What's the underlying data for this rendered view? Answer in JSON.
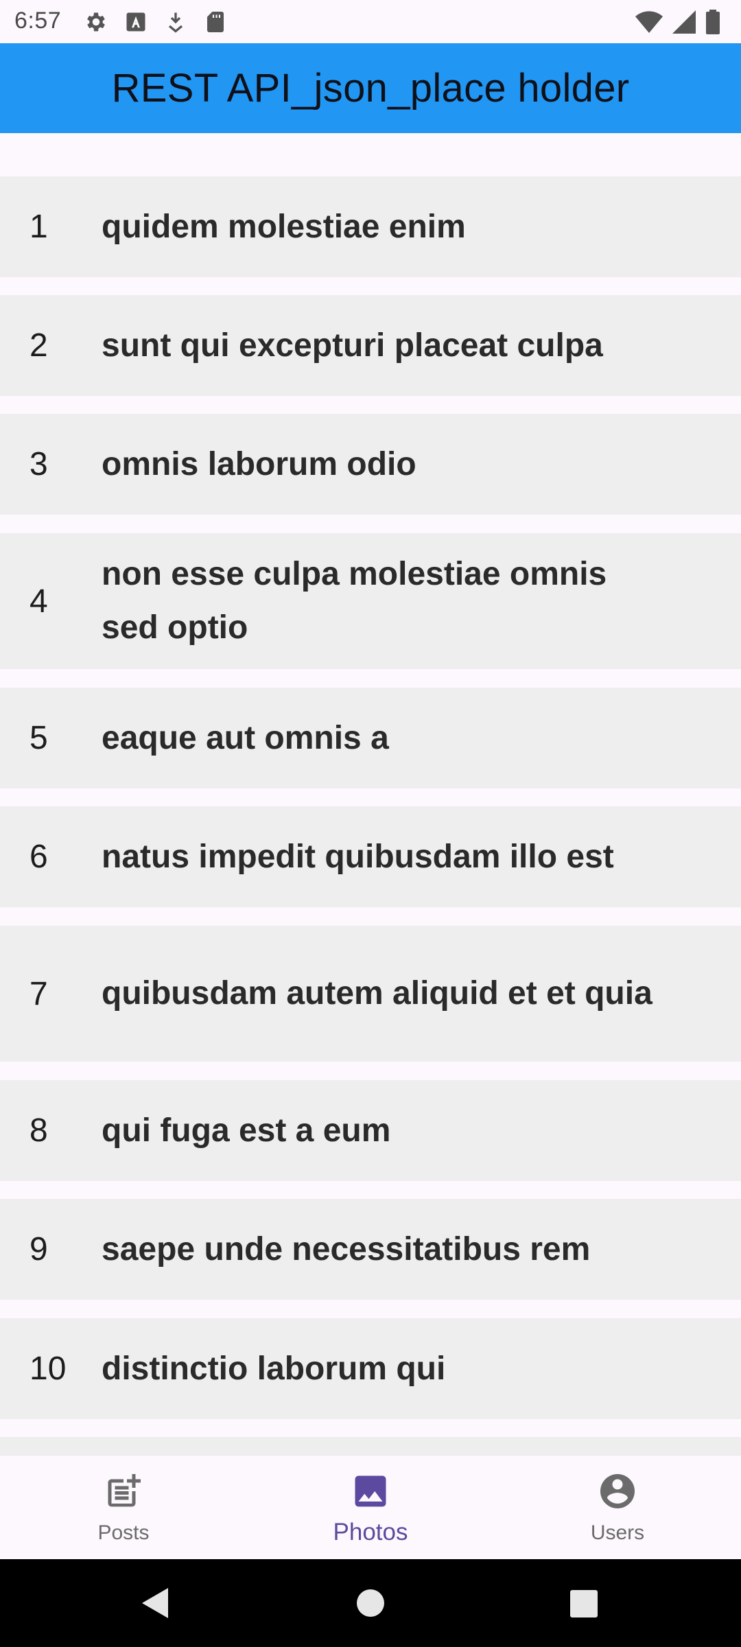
{
  "status_bar": {
    "time": "6:57",
    "icons_left": [
      "gear-icon",
      "font-a-icon",
      "download-arrow-icon",
      "sd-card-icon"
    ],
    "icons_right": [
      "wifi-icon",
      "cell-signal-icon",
      "battery-icon"
    ]
  },
  "app_bar": {
    "title": "REST API_json_place holder",
    "color": "#2196f3"
  },
  "list": {
    "items": [
      {
        "id": "1",
        "title": "quidem molestiae enim"
      },
      {
        "id": "2",
        "title": "sunt qui excepturi placeat culpa"
      },
      {
        "id": "3",
        "title": "omnis laborum odio"
      },
      {
        "id": "4",
        "title": "non esse culpa molestiae omnis sed optio"
      },
      {
        "id": "5",
        "title": "eaque aut omnis a"
      },
      {
        "id": "6",
        "title": "natus impedit quibusdam illo est"
      },
      {
        "id": "7",
        "title": "quibusdam autem aliquid et et quia"
      },
      {
        "id": "8",
        "title": "qui fuga est a eum"
      },
      {
        "id": "9",
        "title": "saepe unde necessitatibus rem"
      },
      {
        "id": "10",
        "title": "distinctio laborum qui"
      }
    ]
  },
  "bottom_nav": {
    "items": [
      {
        "label": "Posts",
        "icon": "post-add-icon",
        "active": false
      },
      {
        "label": "Photos",
        "icon": "image-icon",
        "active": true
      },
      {
        "label": "Users",
        "icon": "account-circle-icon",
        "active": false
      }
    ],
    "active_color": "#5b4a9f"
  },
  "system_nav": {
    "buttons": [
      "back-icon",
      "home-icon",
      "recents-icon"
    ]
  }
}
